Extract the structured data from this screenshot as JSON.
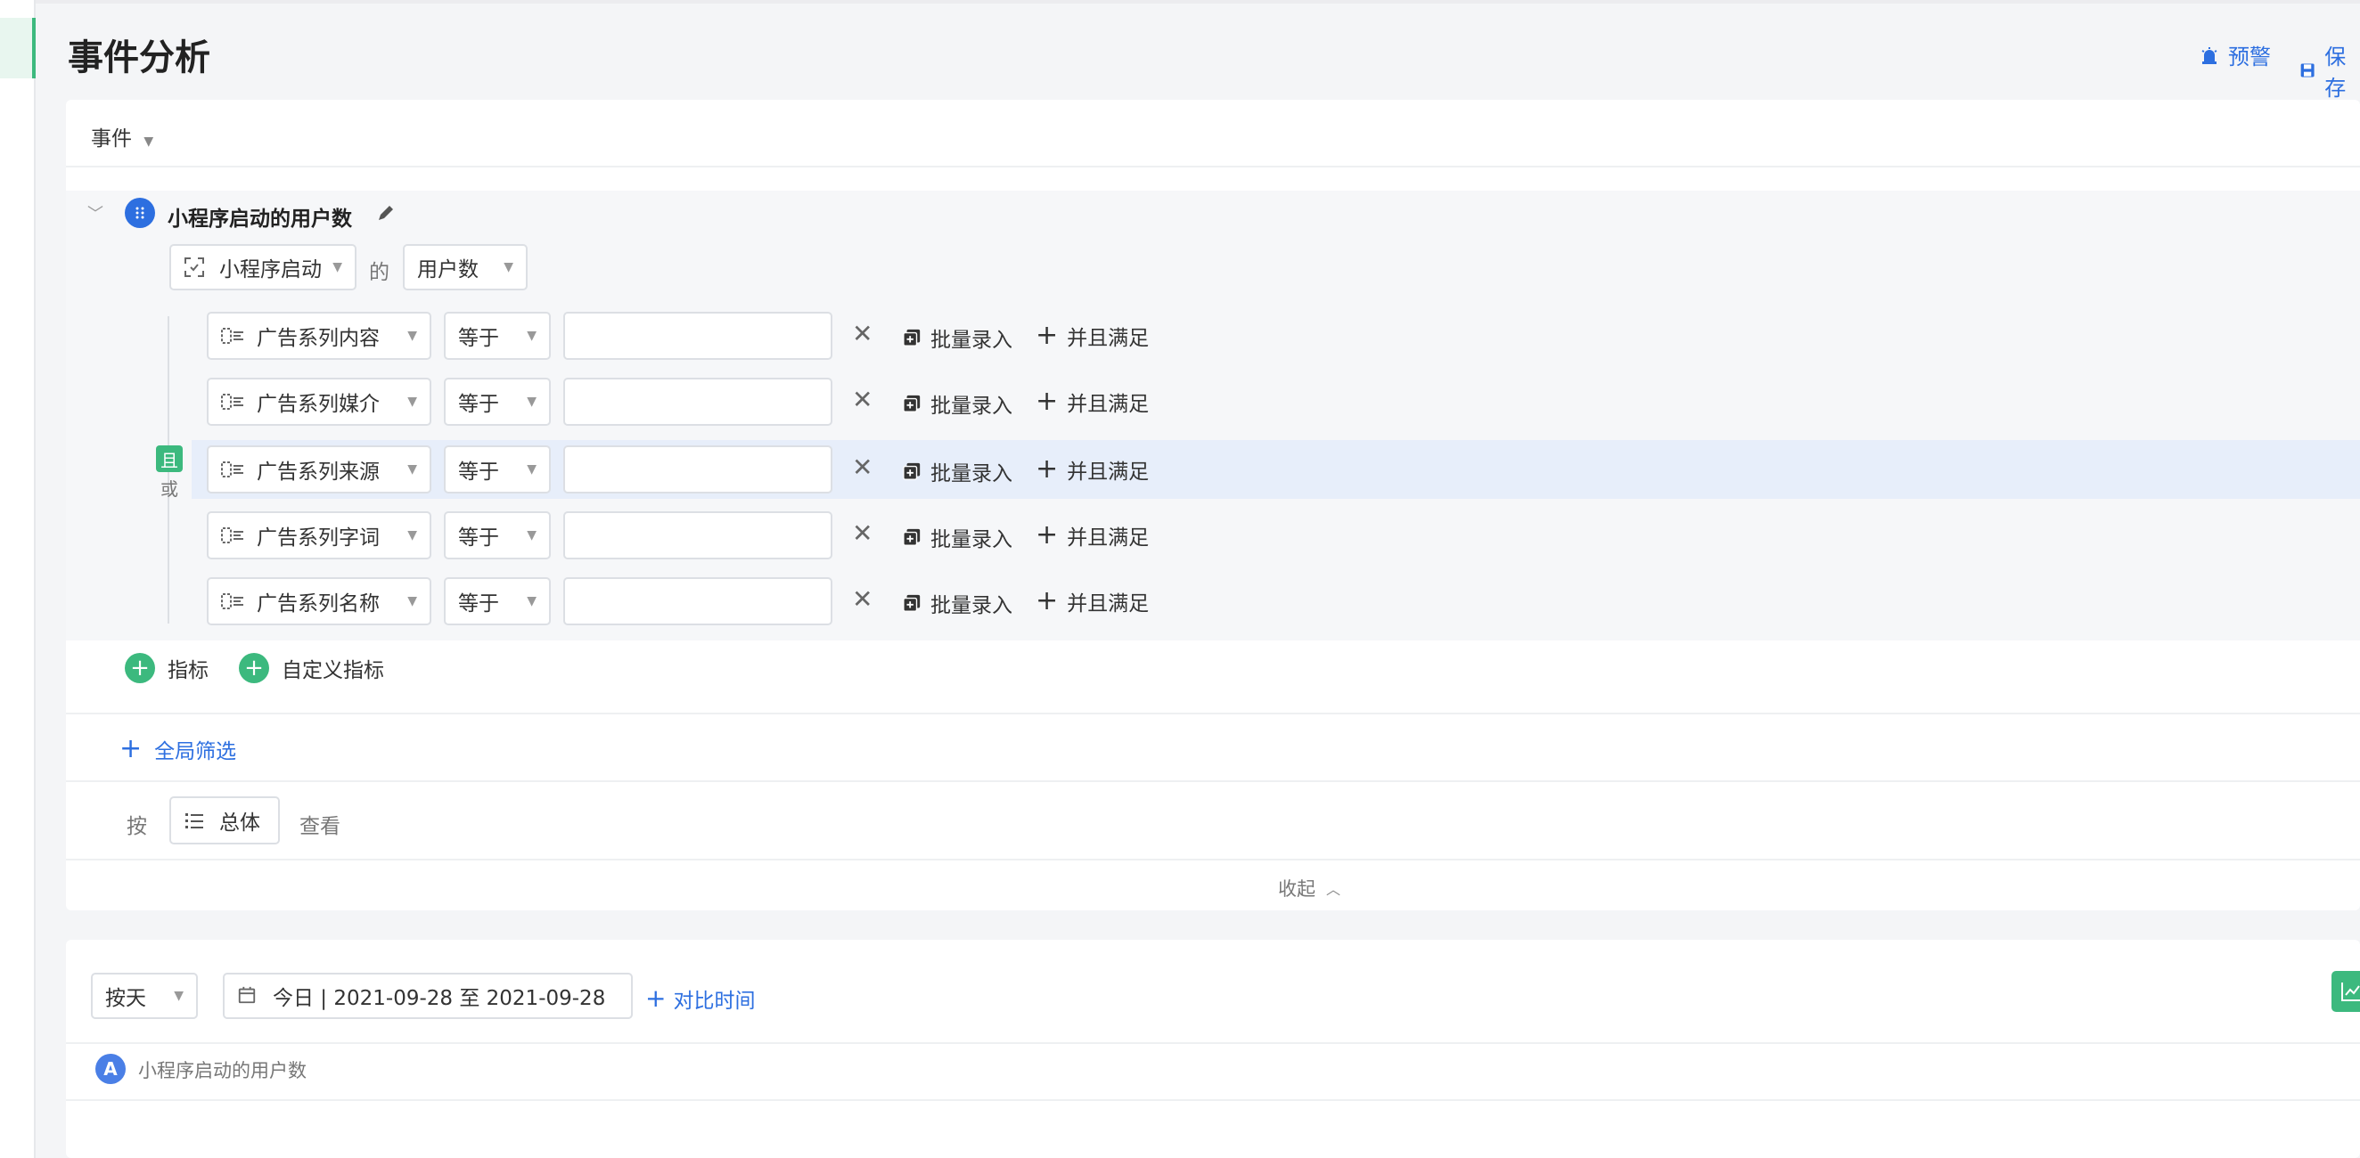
{
  "header": {
    "title": "事件分析",
    "alert_label": "预警",
    "save_label": "保存"
  },
  "event_section": {
    "label": "事件"
  },
  "metric": {
    "name": "小程序启动的用户数",
    "event_select": "小程序启动",
    "of_label": "的",
    "measure_select": "用户数"
  },
  "filters": [
    {
      "property": "广告系列内容",
      "operator": "等于",
      "value": "",
      "batch_label": "批量录入",
      "and_label": "并且满足"
    },
    {
      "property": "广告系列媒介",
      "operator": "等于",
      "value": "",
      "batch_label": "批量录入",
      "and_label": "并且满足"
    },
    {
      "property": "广告系列来源",
      "operator": "等于",
      "value": "",
      "batch_label": "批量录入",
      "and_label": "并且满足"
    },
    {
      "property": "广告系列字词",
      "operator": "等于",
      "value": "",
      "batch_label": "批量录入",
      "and_label": "并且满足"
    },
    {
      "property": "广告系列名称",
      "operator": "等于",
      "value": "",
      "batch_label": "批量录入",
      "and_label": "并且满足"
    }
  ],
  "logic": {
    "and_label": "且",
    "or_label": "或"
  },
  "add_buttons": {
    "metric_label": "指标",
    "custom_metric_label": "自定义指标"
  },
  "global_filter": {
    "label": "全局筛选"
  },
  "group_by": {
    "prefix": "按",
    "select": "总体",
    "suffix": "查看"
  },
  "collapse": {
    "label": "收起"
  },
  "time_bar": {
    "granularity": "按天",
    "date_range": "今日 | 2021-09-28 至 2021-09-28",
    "compare_label": "对比时间"
  },
  "legend": {
    "badge": "A",
    "series_name": "小程序启动的用户数"
  },
  "colors": {
    "accent_blue": "#2d6fe0",
    "accent_green": "#3cb97e",
    "highlight_row": "#e7eefa"
  }
}
